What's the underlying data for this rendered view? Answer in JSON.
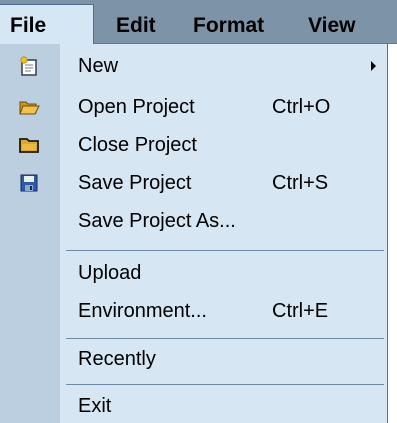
{
  "menubar": {
    "items": [
      {
        "label": "File"
      },
      {
        "label": "Edit"
      },
      {
        "label": "Format"
      },
      {
        "label": "View"
      }
    ]
  },
  "file_menu": {
    "items": [
      {
        "label": "New",
        "shortcut": "",
        "icon": "new-file-icon",
        "submenu": true
      },
      {
        "label": "Open Project",
        "shortcut": "Ctrl+O",
        "icon": "folder-open-icon"
      },
      {
        "label": "Close Project",
        "shortcut": "",
        "icon": "folder-closed-icon"
      },
      {
        "label": "Save Project",
        "shortcut": "Ctrl+S",
        "icon": "floppy-disk-icon"
      },
      {
        "label": "Save Project As...",
        "shortcut": ""
      },
      {
        "label": "Upload",
        "shortcut": ""
      },
      {
        "label": "Environment...",
        "shortcut": "Ctrl+E"
      },
      {
        "label": "Recently",
        "shortcut": ""
      },
      {
        "label": "Exit",
        "shortcut": ""
      }
    ]
  },
  "colors": {
    "menubar_bg": "#7c93a8",
    "menu_bg": "#d7e6f3",
    "gutter_bg": "#bccfe1",
    "separator": "#6f8aa5"
  }
}
